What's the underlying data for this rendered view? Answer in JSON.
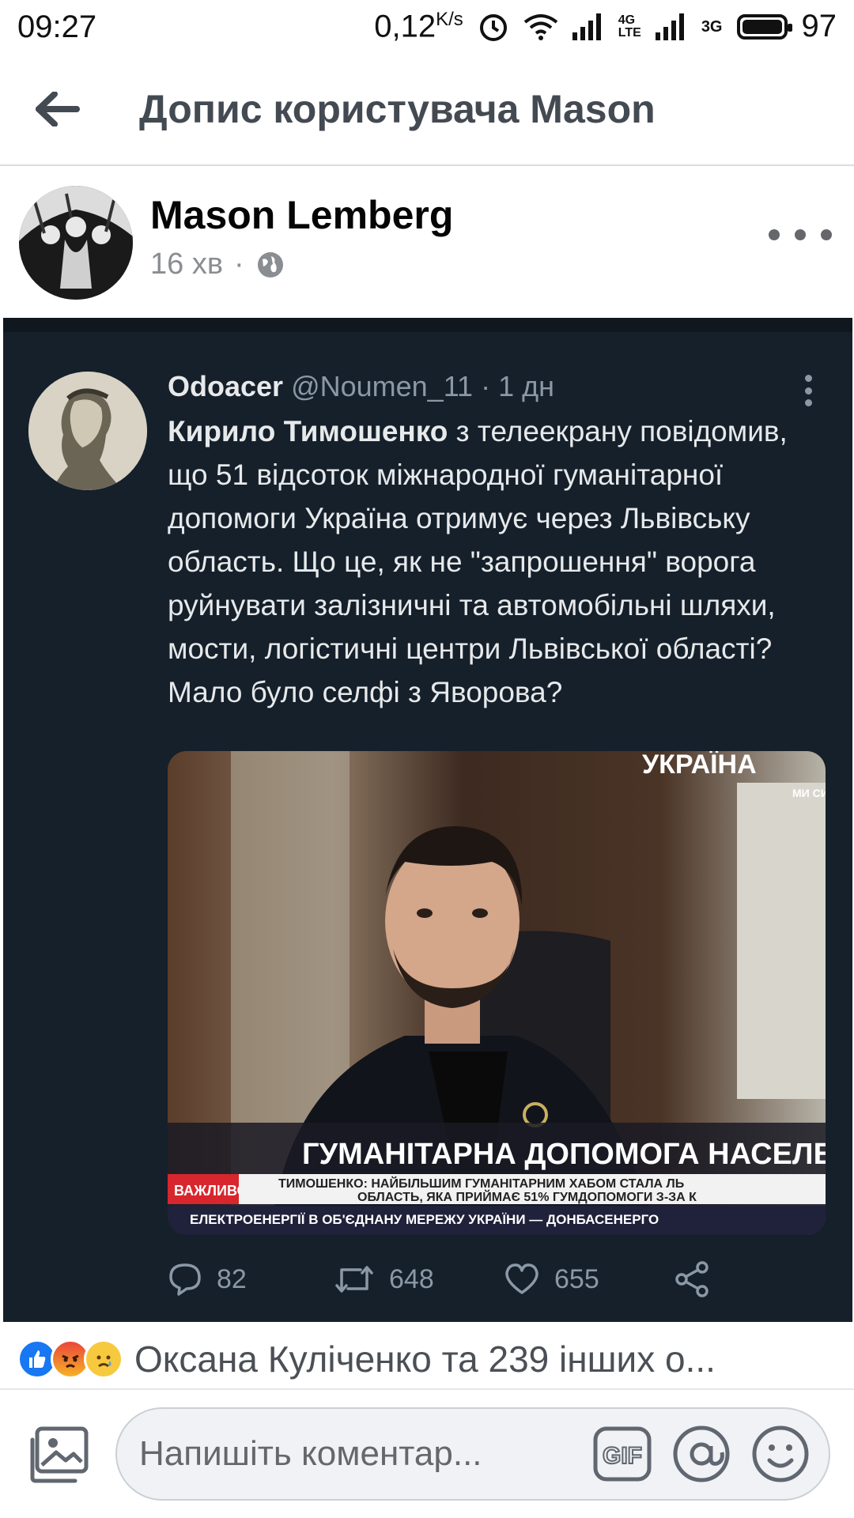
{
  "status_bar": {
    "time": "09:27",
    "speed_value": "0,12",
    "speed_unit": "K/s",
    "net_4g": "4G",
    "net_lte": "LTE",
    "net_3g": "3G",
    "battery": "97"
  },
  "header": {
    "title": "Допис користувача Mason"
  },
  "post": {
    "author": "Mason Lemberg",
    "time": "16 хв",
    "privacy_icon": "globe-icon"
  },
  "tweet": {
    "name": "Odoacer",
    "handle": "@Noumen_11",
    "separator": "·",
    "time": "1 дн",
    "text_bold": "Кирило Тимошенко",
    "text_rest": " з телеекрану повідомив, що 51 відсоток міжнародної гуманітарної допомоги Україна отримує через Львівську область. Що це, як не \"запрошення\" ворога руйнувати залізничні та автомобільні шляхи, мости, логістичні центри Львівської області? Мало було селфі з Яворова?",
    "media": {
      "channel_logo": "УКРАЇНА",
      "channel_sub": "МИ СИ",
      "headline": "ГУМАНІТАРНА ДОПОМОГА НАСЕЛЕ",
      "live_badge": "ВАЖЛИВО",
      "ticker_line1": "ТИМОШЕНКО: НАЙБІЛЬШИМ ГУМАНІТАРНИМ ХАБОМ СТАЛА ЛЬ",
      "ticker_line2": "ОБЛАСТЬ, ЯКА ПРИЙМАЄ 51% ГУМДОПОМОГИ З-ЗА К",
      "ticker_line3": "ЕЛЕКТРОЕНЕРГІЇ В ОБ'ЄДНАНУ МЕРЕЖУ УКРАЇНИ — ДОНБАСЕНЕРГО"
    },
    "replies": "82",
    "retweets": "648",
    "likes": "655"
  },
  "reactions": {
    "text": "Оксана Куліченко та 239 інших о..."
  },
  "composer": {
    "placeholder": "Напишіть коментар...",
    "gif_label": "GIF"
  },
  "colors": {
    "tweet_bg": "#15202b",
    "tweet_text": "#e7e9ea",
    "tweet_muted": "#8b98a5",
    "fb_blue": "#1877f2"
  }
}
